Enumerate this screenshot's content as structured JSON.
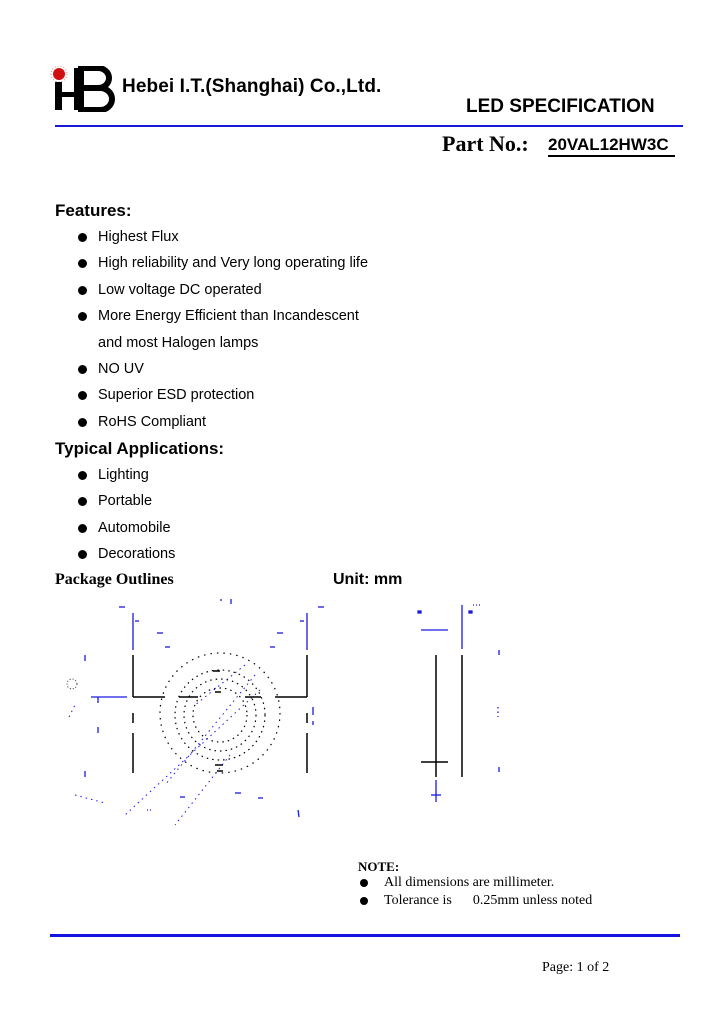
{
  "header": {
    "company_name": "Hebei I.T.(Shanghai) Co.,Ltd.",
    "logo_text": "HB",
    "document_title": "LED SPECIFICATION",
    "part_label": "Part No.:",
    "part_number": "20VAL12HW3C",
    "accent_color": "#1818d8"
  },
  "features": {
    "heading": "Features:",
    "items": [
      {
        "text": "Highest Flux",
        "continuation": false
      },
      {
        "text": "High reliability and Very long operating life",
        "continuation": false
      },
      {
        "text": "Low voltage DC operated",
        "continuation": false
      },
      {
        "text": "More Energy Efficient than Incandescent",
        "continuation": false
      },
      {
        "text": "and most Halogen lamps",
        "continuation": true
      },
      {
        "text": "NO UV",
        "continuation": false
      },
      {
        "text": "Superior ESD protection",
        "continuation": false
      },
      {
        "text": "RoHS Compliant",
        "continuation": false
      }
    ]
  },
  "applications": {
    "heading": "Typical Applications:",
    "items": [
      "Lighting",
      "Portable",
      "Automobile",
      "Decorations"
    ]
  },
  "package": {
    "heading": "Package Outlines",
    "unit_label": "Unit: mm"
  },
  "notes": {
    "heading": "NOTE:",
    "items": [
      "All dimensions are millimeter.",
      "Tolerance is      0.25mm unless noted"
    ]
  },
  "footer": {
    "page_label": "Page: 1 of 2"
  }
}
